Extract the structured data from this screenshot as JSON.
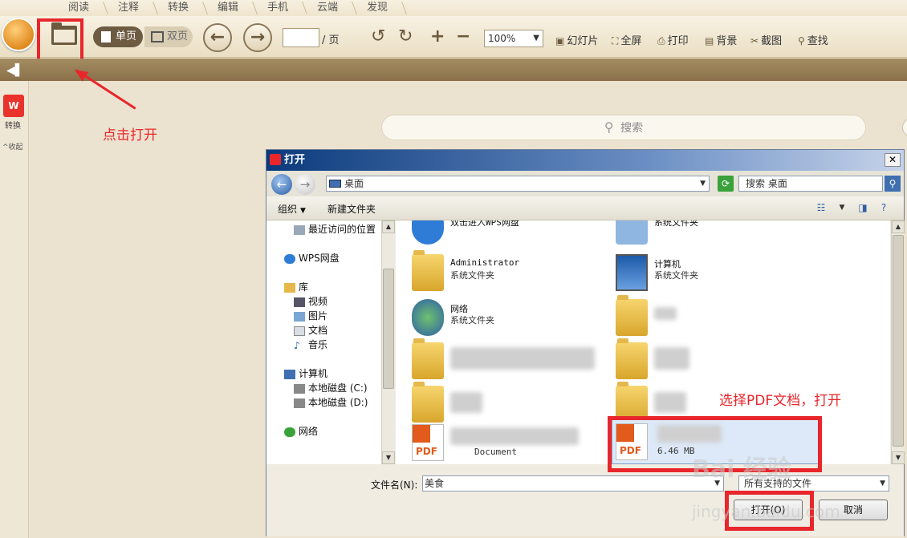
{
  "menu": {
    "tabs": [
      "阅读",
      "注释",
      "转换",
      "编辑",
      "手机",
      "云端",
      "发现"
    ]
  },
  "toolbar": {
    "single_page": "单页",
    "double_page": "双页",
    "page_suffix": "/ 页",
    "zoom": "100%",
    "slideshow": "幻灯片",
    "fullscreen": "全屏",
    "print": "打印",
    "background": "背景",
    "screenshot": "截图",
    "find": "查找"
  },
  "sidebar": {
    "convert": "转换",
    "collapse": "收起"
  },
  "main": {
    "search_placeholder": "搜索"
  },
  "annotations": {
    "click_open": "点击打开",
    "select_pdf": "选择PDF文档，打开"
  },
  "dialog": {
    "title": "打开",
    "address": "桌面",
    "search": "搜索 桌面",
    "organize": "组织",
    "new_folder": "新建文件夹",
    "nav": {
      "recent": "最近访问的位置",
      "wps_cloud": "WPS网盘",
      "library": "库",
      "videos": "视频",
      "pictures": "图片",
      "documents": "文档",
      "music": "音乐",
      "computer": "计算机",
      "disk_c": "本地磁盘 (C:)",
      "disk_d": "本地磁盘 (D:)",
      "network": "网络"
    },
    "files": {
      "wps_disk": "双击进入WPS网盘",
      "sys_folder": "系统文件夹",
      "admin": "Administrator",
      "computer": "计算机",
      "network": "网络",
      "pdf_doc_suffix": "Document",
      "pdf_size": "6.46 MB"
    },
    "filename_label": "文件名(N):",
    "filename_value": "美食",
    "filetype": "所有支持的文件",
    "open_btn": "打开(O)",
    "cancel_btn": "取消"
  },
  "colors": {
    "annotation_red": "#e8262b",
    "toolbar_brown": "#6b5a3e",
    "dialog_blue": "#0b3a7c"
  },
  "watermark": {
    "main": "Bai 经验",
    "url": "jingyan.baidu.com"
  }
}
